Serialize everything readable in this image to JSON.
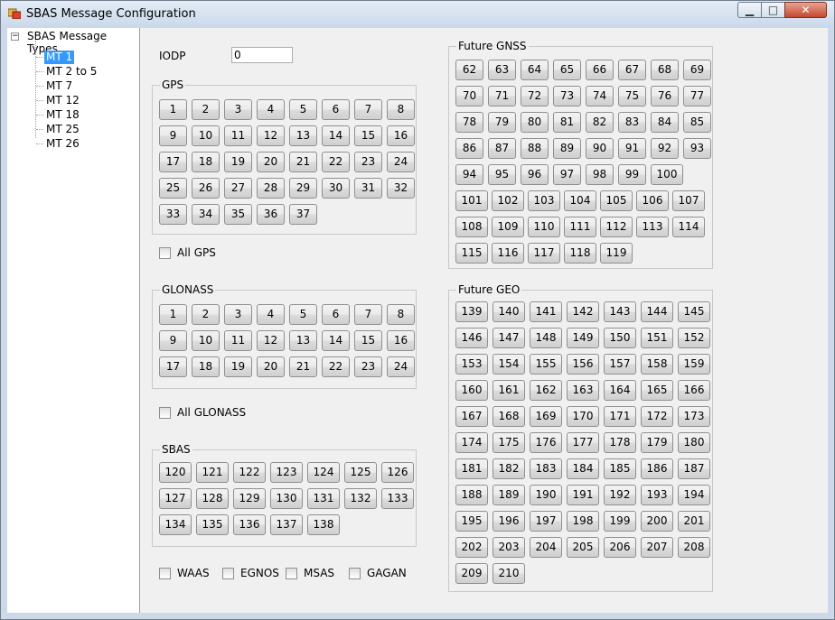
{
  "window": {
    "title": "SBAS Message Configuration"
  },
  "title_buttons": {
    "minimize": "▁",
    "maximize": "□",
    "close": "✕"
  },
  "tree": {
    "root": "SBAS Message Types",
    "expander": "−",
    "items": [
      "MT 1",
      "MT 2 to 5",
      "MT 7",
      "MT 12",
      "MT 18",
      "MT 25",
      "MT 26"
    ],
    "selected_index": 0
  },
  "iodp": {
    "label": "IODP",
    "value": "0"
  },
  "gps": {
    "title": "GPS",
    "buttons": [
      "1",
      "2",
      "3",
      "4",
      "5",
      "6",
      "7",
      "8",
      "9",
      "10",
      "11",
      "12",
      "13",
      "14",
      "15",
      "16",
      "17",
      "18",
      "19",
      "20",
      "21",
      "22",
      "23",
      "24",
      "25",
      "26",
      "27",
      "28",
      "29",
      "30",
      "31",
      "32",
      "33",
      "34",
      "35",
      "36",
      "37"
    ],
    "all_label": "All GPS"
  },
  "glonass": {
    "title": "GLONASS",
    "buttons": [
      "1",
      "2",
      "3",
      "4",
      "5",
      "6",
      "7",
      "8",
      "9",
      "10",
      "11",
      "12",
      "13",
      "14",
      "15",
      "16",
      "17",
      "18",
      "19",
      "20",
      "21",
      "22",
      "23",
      "24"
    ],
    "all_label": "All GLONASS"
  },
  "sbas": {
    "title": "SBAS",
    "buttons": [
      "120",
      "121",
      "122",
      "123",
      "124",
      "125",
      "126",
      "127",
      "128",
      "129",
      "130",
      "131",
      "132",
      "133",
      "134",
      "135",
      "136",
      "137",
      "138"
    ]
  },
  "sbas_systems": [
    "WAAS",
    "EGNOS",
    "MSAS",
    "GAGAN"
  ],
  "future_gnss": {
    "title": "Future GNSS",
    "buttons": [
      "62",
      "63",
      "64",
      "65",
      "66",
      "67",
      "68",
      "69",
      "70",
      "71",
      "72",
      "73",
      "74",
      "75",
      "76",
      "77",
      "78",
      "79",
      "80",
      "81",
      "82",
      "83",
      "84",
      "85",
      "86",
      "87",
      "88",
      "89",
      "90",
      "91",
      "92",
      "93",
      "94",
      "95",
      "96",
      "97",
      "98",
      "99",
      "100",
      "101",
      "102",
      "103",
      "104",
      "105",
      "106",
      "107",
      "108",
      "109",
      "110",
      "111",
      "112",
      "113",
      "114",
      "115",
      "116",
      "117",
      "118",
      "119"
    ]
  },
  "future_geo": {
    "title": "Future GEO",
    "buttons": [
      "139",
      "140",
      "141",
      "142",
      "143",
      "144",
      "145",
      "146",
      "147",
      "148",
      "149",
      "150",
      "151",
      "152",
      "153",
      "154",
      "155",
      "156",
      "157",
      "158",
      "159",
      "160",
      "161",
      "162",
      "163",
      "164",
      "165",
      "166",
      "167",
      "168",
      "169",
      "170",
      "171",
      "172",
      "173",
      "174",
      "175",
      "176",
      "177",
      "178",
      "179",
      "180",
      "181",
      "182",
      "183",
      "184",
      "185",
      "186",
      "187",
      "188",
      "189",
      "190",
      "191",
      "192",
      "193",
      "194",
      "195",
      "196",
      "197",
      "198",
      "199",
      "200",
      "201",
      "202",
      "203",
      "204",
      "205",
      "206",
      "207",
      "208",
      "209",
      "210"
    ]
  }
}
